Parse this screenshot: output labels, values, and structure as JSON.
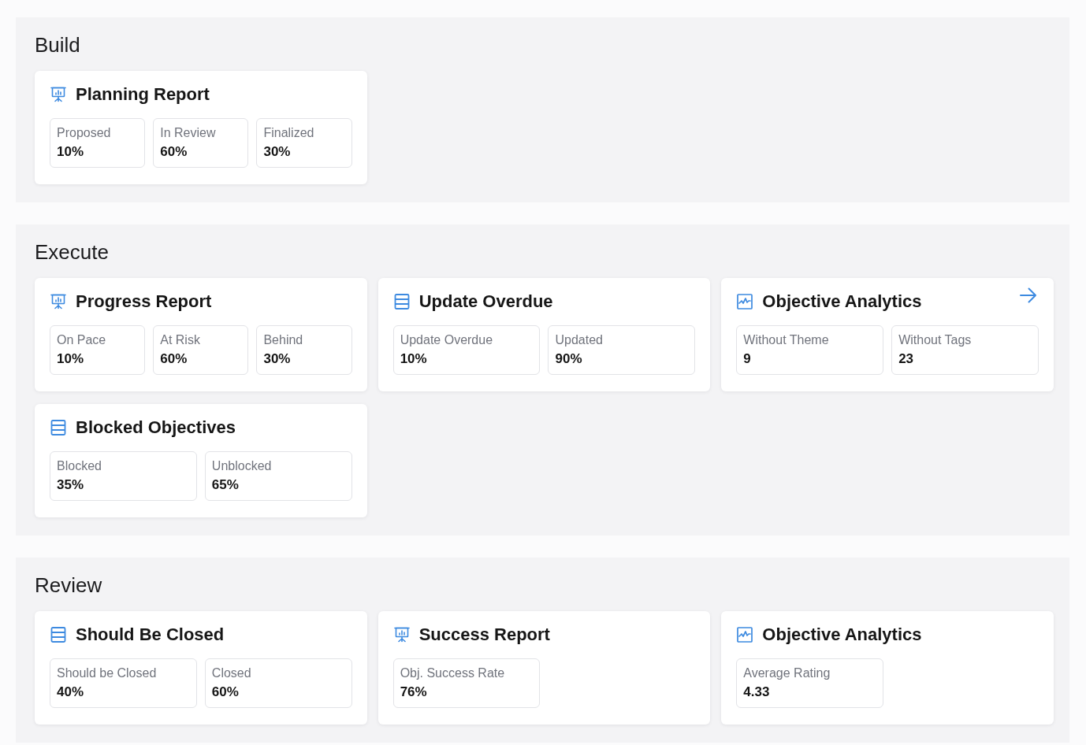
{
  "sections": [
    {
      "title": "Build",
      "cards": [
        {
          "kind": "presentation",
          "title": "Planning Report",
          "link_arrow": false,
          "stats": [
            {
              "label": "Proposed",
              "value": "10%"
            },
            {
              "label": "In Review",
              "value": "60%"
            },
            {
              "label": "Finalized",
              "value": "30%"
            }
          ]
        }
      ]
    },
    {
      "title": "Execute",
      "cards": [
        {
          "kind": "presentation",
          "title": "Progress Report",
          "link_arrow": false,
          "stats": [
            {
              "label": "On Pace",
              "value": "10%"
            },
            {
              "label": "At Risk",
              "value": "60%"
            },
            {
              "label": "Behind",
              "value": "30%"
            }
          ]
        },
        {
          "kind": "list",
          "title": "Update Overdue",
          "link_arrow": false,
          "stats": [
            {
              "label": "Update Overdue",
              "value": "10%"
            },
            {
              "label": "Updated",
              "value": "90%"
            }
          ]
        },
        {
          "kind": "analytics",
          "title": "Objective Analytics",
          "link_arrow": true,
          "stats": [
            {
              "label": "Without Theme",
              "value": "9"
            },
            {
              "label": "Without Tags",
              "value": "23"
            }
          ]
        },
        {
          "kind": "list",
          "title": "Blocked Objectives",
          "link_arrow": false,
          "stats": [
            {
              "label": "Blocked",
              "value": "35%"
            },
            {
              "label": "Unblocked",
              "value": "65%"
            }
          ]
        }
      ]
    },
    {
      "title": "Review",
      "cards": [
        {
          "kind": "list",
          "title": "Should Be Closed",
          "link_arrow": false,
          "stats": [
            {
              "label": "Should be Closed",
              "value": "40%"
            },
            {
              "label": "Closed",
              "value": "60%"
            }
          ]
        },
        {
          "kind": "presentation",
          "title": "Success Report",
          "link_arrow": false,
          "stats": [
            {
              "label": "Obj. Success Rate",
              "value": "76%"
            }
          ]
        },
        {
          "kind": "analytics",
          "title": "Objective Analytics",
          "link_arrow": false,
          "stats": [
            {
              "label": "Average Rating",
              "value": "4.33"
            }
          ]
        }
      ]
    }
  ]
}
